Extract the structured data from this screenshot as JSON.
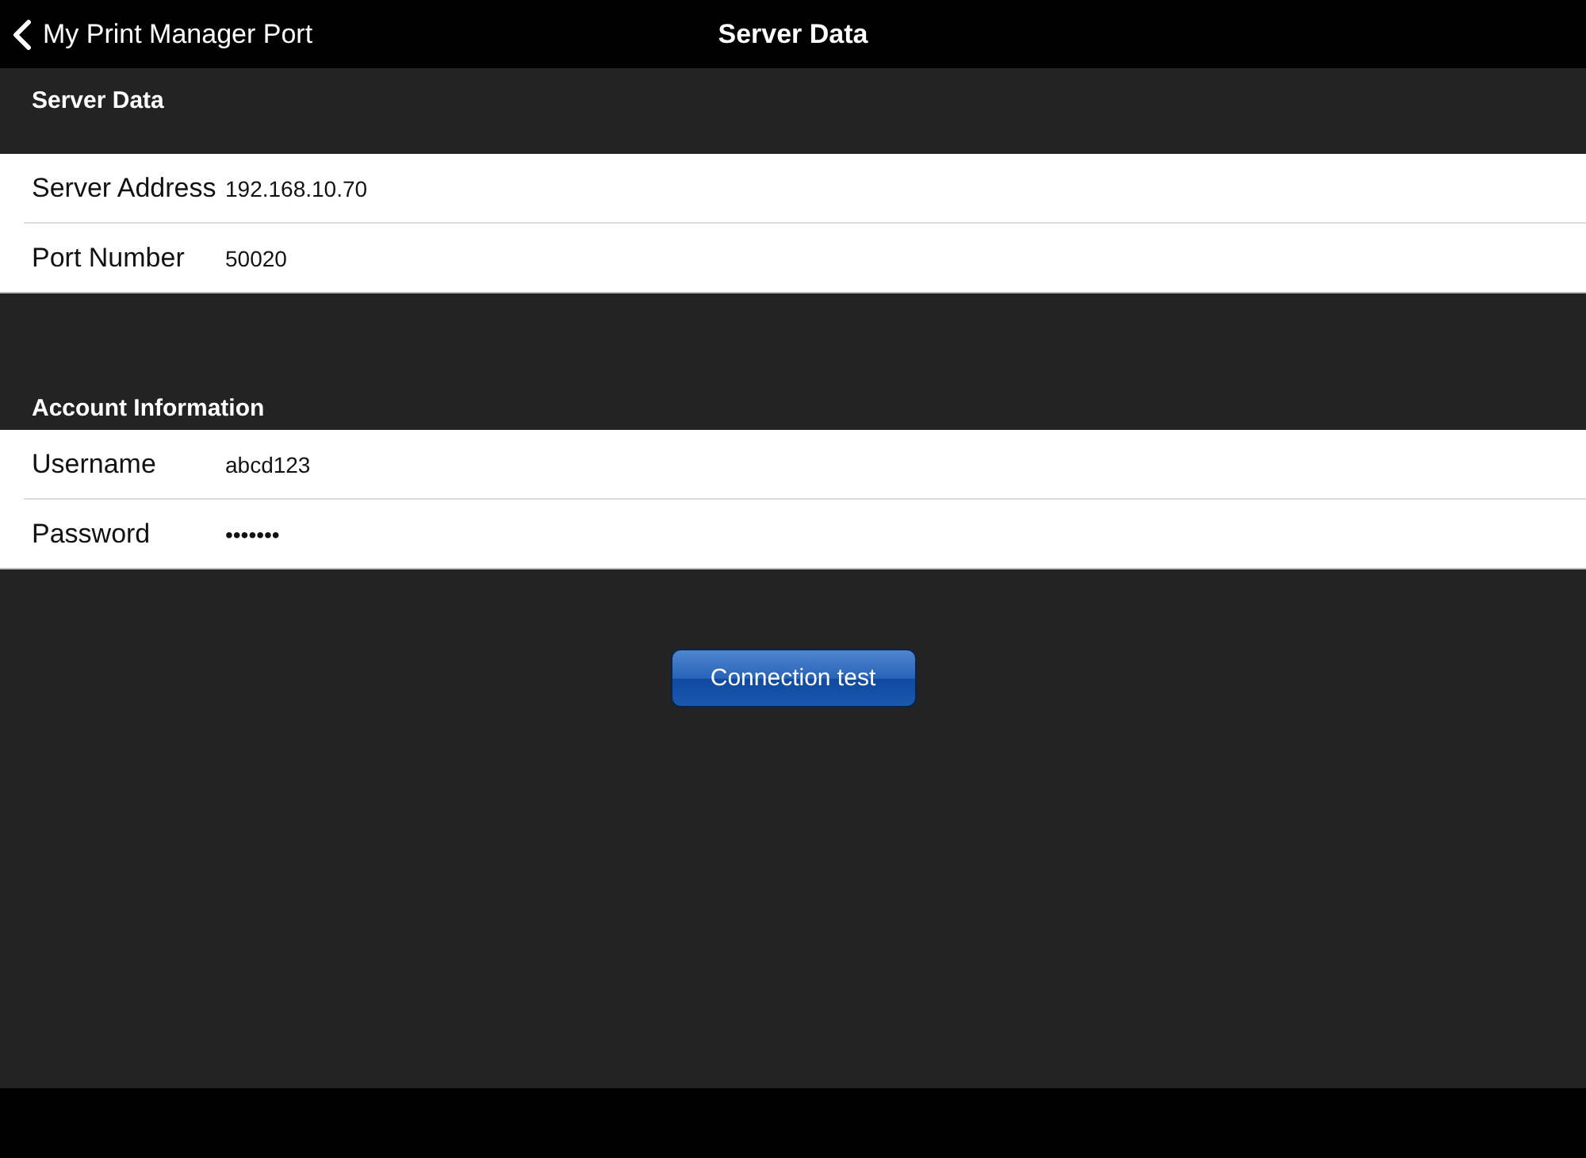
{
  "nav_bar": {
    "back_label": "My Print Manager Port",
    "title": "Server Data"
  },
  "sections": [
    {
      "header": "Server Data",
      "rows": [
        {
          "label": "Server Address",
          "value": "192.168.10.70"
        },
        {
          "label": "Port Number",
          "value": "50020"
        }
      ]
    },
    {
      "header": "Account Information",
      "rows": [
        {
          "label": "Username",
          "value": "abcd123"
        },
        {
          "label": "Password",
          "value": "•••••••"
        }
      ]
    }
  ],
  "button": {
    "label": "Connection test"
  }
}
